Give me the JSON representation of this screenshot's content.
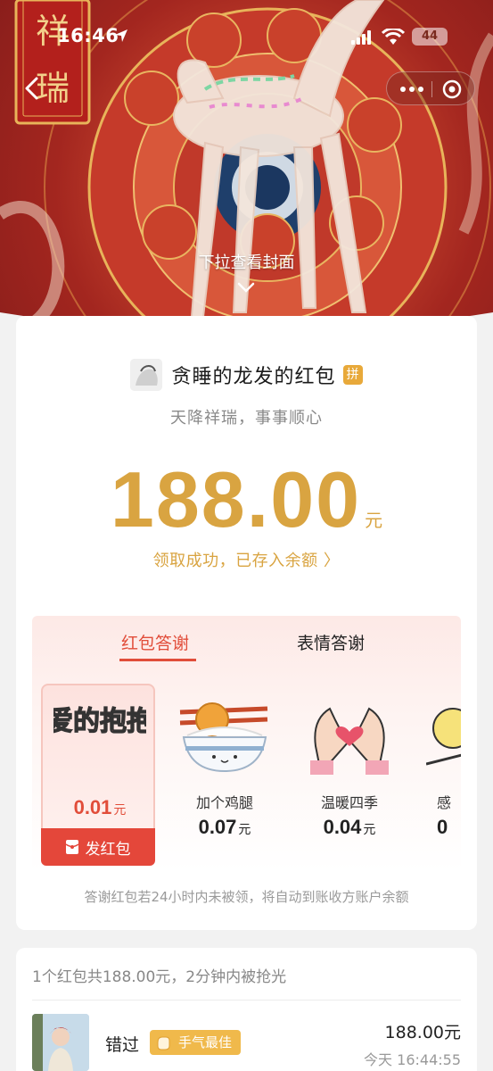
{
  "status_bar": {
    "time": "16:46",
    "battery": "44"
  },
  "cover": {
    "seal_text": "祥瑞",
    "pull_hint": "下拉查看封面"
  },
  "envelope": {
    "sender_name": "贪睡的龙发的红包",
    "pin_badge": "拼",
    "blessing": "天降祥瑞，事事顺心",
    "amount": "188.00",
    "unit": "元",
    "claim_status": "领取成功，已存入余额 〉"
  },
  "thanks": {
    "tabs": [
      {
        "label": "红包答谢",
        "active": true
      },
      {
        "label": "表情答谢",
        "active": false
      }
    ],
    "gifts": [
      {
        "image_text": "爱的抱抱",
        "price": "0.01",
        "unit": "元",
        "button": "发红包",
        "selected": true
      },
      {
        "name": "加个鸡腿",
        "price": "0.07",
        "unit": "元"
      },
      {
        "name": "温暖四季",
        "price": "0.04",
        "unit": "元"
      },
      {
        "name": "感",
        "price": "0"
      }
    ],
    "note": "答谢红包若24小时内未被领，将自动到账收方账户余额"
  },
  "records": {
    "summary": "1个红包共188.00元，2分钟内被抢光",
    "items": [
      {
        "name": "错过",
        "badge": "手气最佳",
        "amount": "188.00元",
        "time": "今天 16:44:55"
      }
    ]
  },
  "colors": {
    "red": "#e14d3a",
    "gold": "#d9a441",
    "badge_gold": "#f0b94b"
  }
}
